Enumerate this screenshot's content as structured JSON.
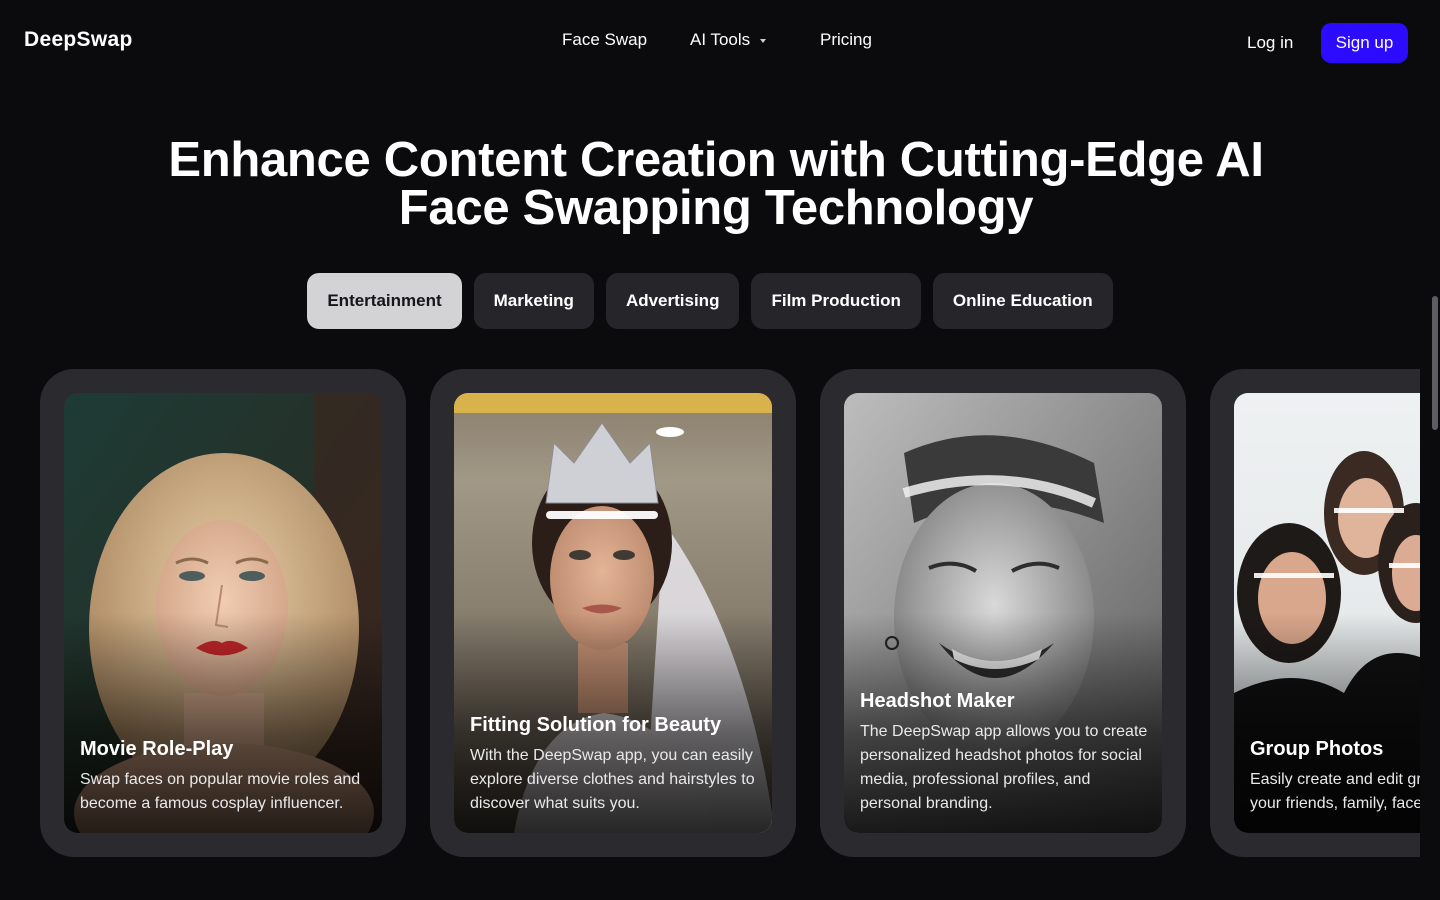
{
  "header": {
    "logo": "DeepSwap",
    "nav": {
      "face_swap": "Face Swap",
      "ai_tools": "AI Tools",
      "pricing": "Pricing"
    },
    "login": "Log in",
    "signup": "Sign up"
  },
  "hero": {
    "title_line1": "Enhance Content Creation with Cutting-Edge AI",
    "title_line2": "Face Swapping Technology"
  },
  "tabs": [
    {
      "label": "Entertainment",
      "active": true
    },
    {
      "label": "Marketing",
      "active": false
    },
    {
      "label": "Advertising",
      "active": false
    },
    {
      "label": "Film Production",
      "active": false
    },
    {
      "label": "Online Education",
      "active": false
    }
  ],
  "cards": [
    {
      "title": "Movie Role-Play",
      "description": "Swap faces on popular movie roles and become a famous cosplay influencer."
    },
    {
      "title": "Fitting Solution for Beauty",
      "description": "With the DeepSwap app, you can easily explore diverse clothes and hairstyles to discover what suits you."
    },
    {
      "title": "Headshot Maker",
      "description": "The DeepSwap app allows you to create personalized headshot photos for social media, professional profiles, and personal branding."
    },
    {
      "title": "Group Photos",
      "description": "Easily create and edit group photos with your friends, family, face swapping."
    }
  ],
  "colors": {
    "background": "#0b0b0d",
    "card": "#2a2a2f",
    "tab": "#25252a",
    "tab_active": "#d3d3d6",
    "accent": "#2d0bff"
  }
}
